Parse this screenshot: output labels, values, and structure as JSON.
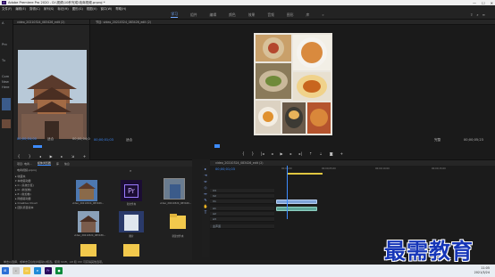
{
  "app": {
    "title": "Adobe Premiere Pro 2020 - D:\\视频\\10秒完成\\电商视频.prproj *"
  },
  "menu": [
    "文件(F)",
    "编辑(E)",
    "剪辑(C)",
    "序列(S)",
    "标记(M)",
    "图形(G)",
    "视图(V)",
    "窗口(W)",
    "帮助(H)"
  ],
  "workspace": {
    "tabs": [
      "学习",
      "组件",
      "编辑",
      "颜色",
      "效果",
      "音频",
      "图形",
      "库"
    ],
    "active": "学习"
  },
  "left_strip": {
    "labels": [
      "A",
      "Pro",
      "Tu",
      "Com",
      "New",
      "Here"
    ]
  },
  "source": {
    "header": "video_20210324_083426_edit (2)",
    "timecode": "00;00;04;00",
    "fit": "适合",
    "duration": "00;00;04;00"
  },
  "program": {
    "header": "节目: video_20210324_083426_edit (2)",
    "timecode": "00;00;01;03",
    "fit": "适合",
    "quality": "完整",
    "duration": "00;00;05;23"
  },
  "project": {
    "tabs": [
      "项目: 电商...",
      "媒体浏览器",
      "库",
      "信息"
    ],
    "path": "电商视频.prproj",
    "tree": [
      "▸ 收藏夹",
      "▾ 本地驱动器",
      "  ▸ C: (系统分区)",
      "  ▸ D: (新加卷)",
      "  ▸ E: (新加卷)",
      "▸ 网络驱动器",
      "▸ Creative Cloud",
      "  ▸ 团队项目版本"
    ],
    "items": [
      {
        "caption": "video_20210324_083426..."
      },
      {
        "caption": "新文件夹"
      },
      {
        "caption": "video_20210324_083426..."
      },
      {
        "caption": "video_20210324_083436..."
      },
      {
        "caption": "图片"
      },
      {
        "caption": "新建文件夹"
      }
    ]
  },
  "timeline": {
    "header": "video_20210324_083426_edit (2)",
    "timecode": "00;00;01;03",
    "ruler": [
      "00;00;00",
      "00;00;05;00",
      "00;00;10;00",
      "00;00;15;00"
    ],
    "tracks": [
      "V3",
      "V2",
      "V1",
      "A1",
      "A2",
      "A3",
      "主声道"
    ]
  },
  "statusbar": "单击以选择，或单击空白处并拖动以框选。使用 Shift、Alt 和 Ctrl 可获得其他选项。",
  "clock": {
    "time": "11:05",
    "date": "2021/3/24"
  },
  "watermark": "最需教育",
  "colors": {
    "accent": "#3d8cff",
    "clip_video": "#7fa3d8",
    "clip_audio": "#5fa79a",
    "watermark": "#1636b8"
  }
}
